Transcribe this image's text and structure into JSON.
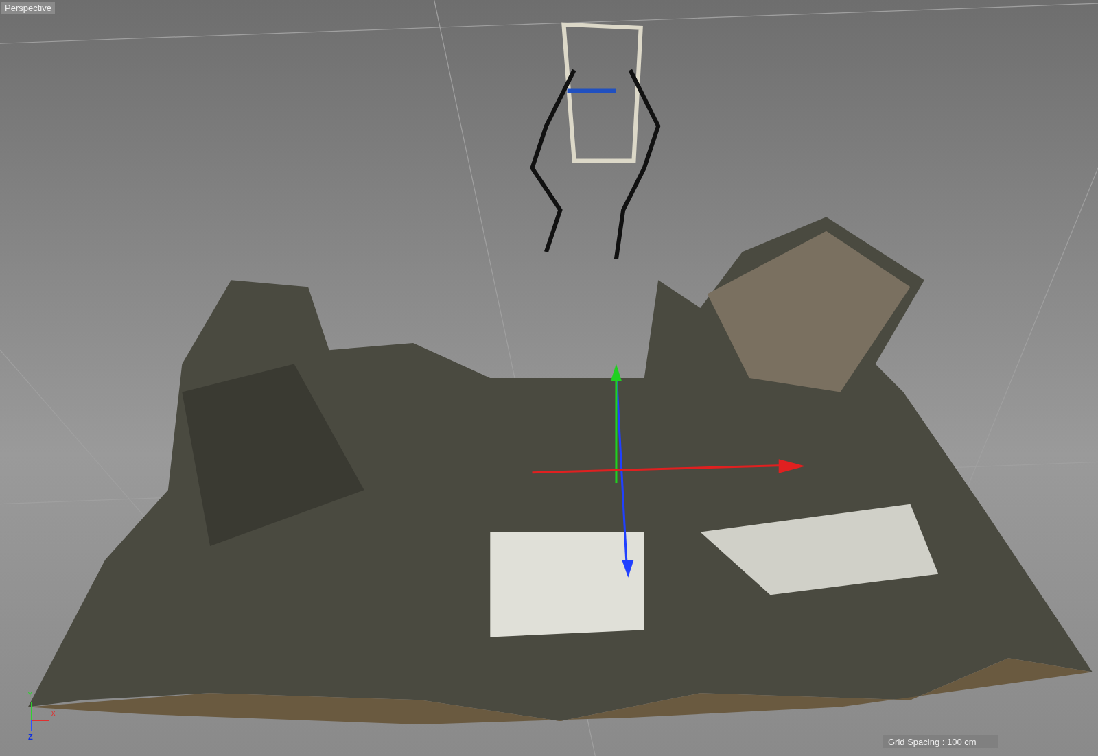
{
  "viewport": {
    "label": "Perspective"
  },
  "axis_gizmo": {
    "y_label": "Y",
    "x_label": "X",
    "z_label": "Z"
  },
  "status": {
    "grid_spacing": "Grid Spacing : 100 cm"
  }
}
